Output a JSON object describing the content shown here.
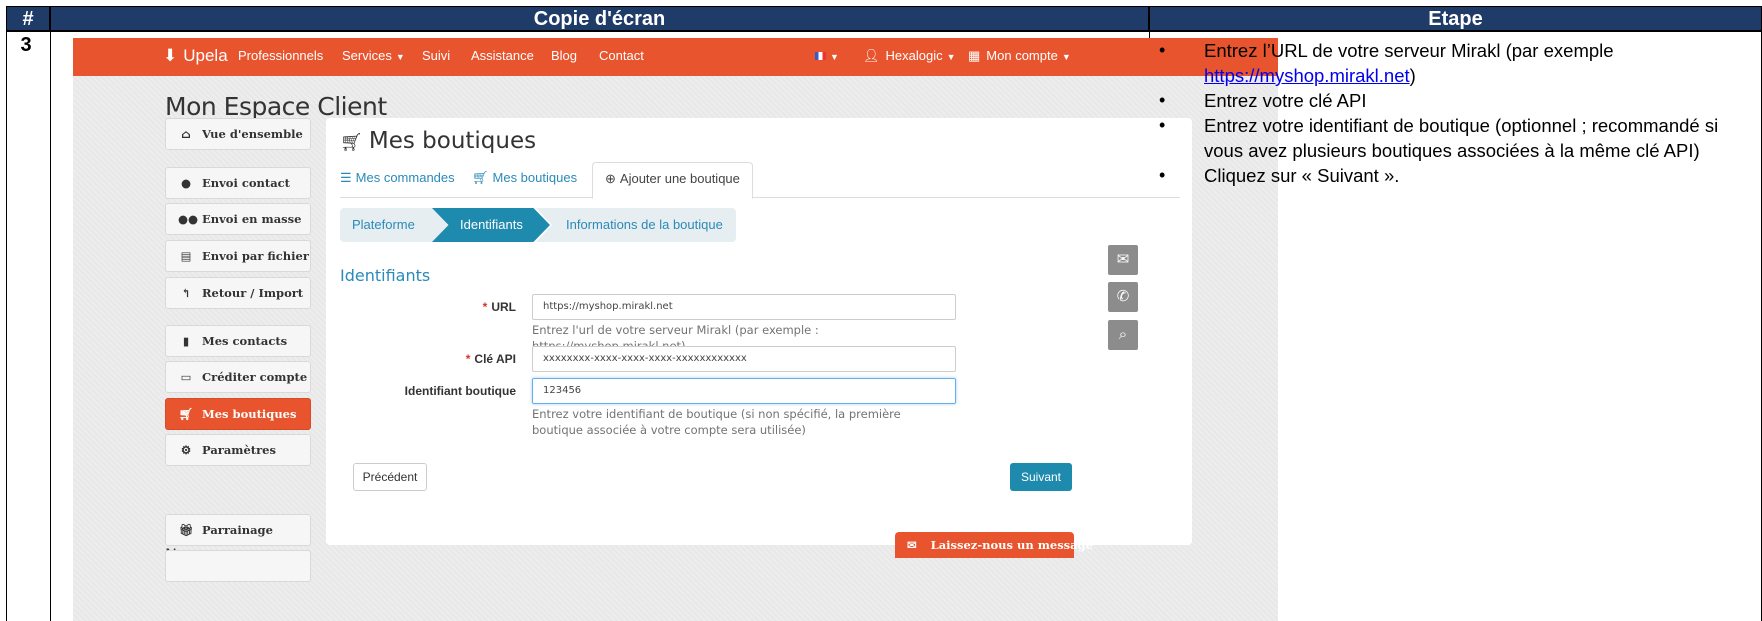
{
  "table": {
    "col_num": "#",
    "col_shot": "Copie d'écran",
    "col_step": "Etape",
    "row_number": "3"
  },
  "navbar": {
    "brand": "Upela",
    "items": [
      "Professionnels",
      "Services",
      "Suivi",
      "Assistance",
      "Blog",
      "Contact"
    ],
    "user": "Hexalogic",
    "account": "Mon compte"
  },
  "page_title": "Mon Espace Client",
  "sidebar": {
    "items": [
      {
        "label": "Vue d'ensemble",
        "icon": "home-icon"
      },
      {
        "label": "Envoi contact",
        "icon": "user-icon"
      },
      {
        "label": "Envoi en masse",
        "icon": "users-icon"
      },
      {
        "label": "Envoi par fichier",
        "icon": "file-icon"
      },
      {
        "label": "Retour / Import",
        "icon": "reply-icon"
      },
      {
        "label": "Mes contacts",
        "icon": "book-icon"
      },
      {
        "label": "Créditer compte",
        "icon": "credit-card-icon"
      },
      {
        "label": "Mes boutiques",
        "icon": "cart-icon",
        "active": true
      },
      {
        "label": "Paramètres",
        "icon": "gears-icon"
      },
      {
        "label": "Parrainage",
        "icon": "gift-icon"
      }
    ],
    "programs_heading": "Nos programmes"
  },
  "panel": {
    "title": "Mes boutiques",
    "tabs": [
      "Mes commandes",
      "Mes boutiques",
      "Ajouter une boutique"
    ],
    "active_tab": "Ajouter une boutique",
    "wizard_steps": [
      "Plateforme",
      "Identifiants",
      "Informations de la boutique"
    ],
    "current_step": "Identifiants",
    "section_title": "Identifiants",
    "form": {
      "url_label": "URL",
      "url_value": "https://myshop.mirakl.net",
      "url_help": "Entrez l'url de votre serveur Mirakl (par exemple : https://myshop.mirakl.net)",
      "api_label": "Clé API",
      "api_value": "xxxxxxxx-xxxx-xxxx-xxxx-xxxxxxxxxxxx",
      "shop_label": "Identifiant boutique",
      "shop_value": "123456",
      "shop_help": "Entrez votre identifiant de boutique (si non spécifié, la première boutique associée à votre compte sera utilisée)"
    },
    "prev_button": "Précédent",
    "next_button": "Suivant"
  },
  "message_button": "Laissez-nous un message",
  "steps": {
    "s1_before": "Entrez l’URL de votre serveur Mirakl (par exemple ",
    "s1_link": "https://myshop.mirakl.net",
    "s1_after": ")",
    "s2": "Entrez votre clé API",
    "s3": "Entrez votre identifiant de boutique (optionnel ; recommandé si vous avez plusieurs boutiques associées à la même clé API)",
    "s4": "Cliquez sur « Suivant »."
  },
  "colors": {
    "header_bg": "#1f3b68",
    "brand_orange": "#e8542e",
    "accent_blue": "#1e8aad"
  }
}
